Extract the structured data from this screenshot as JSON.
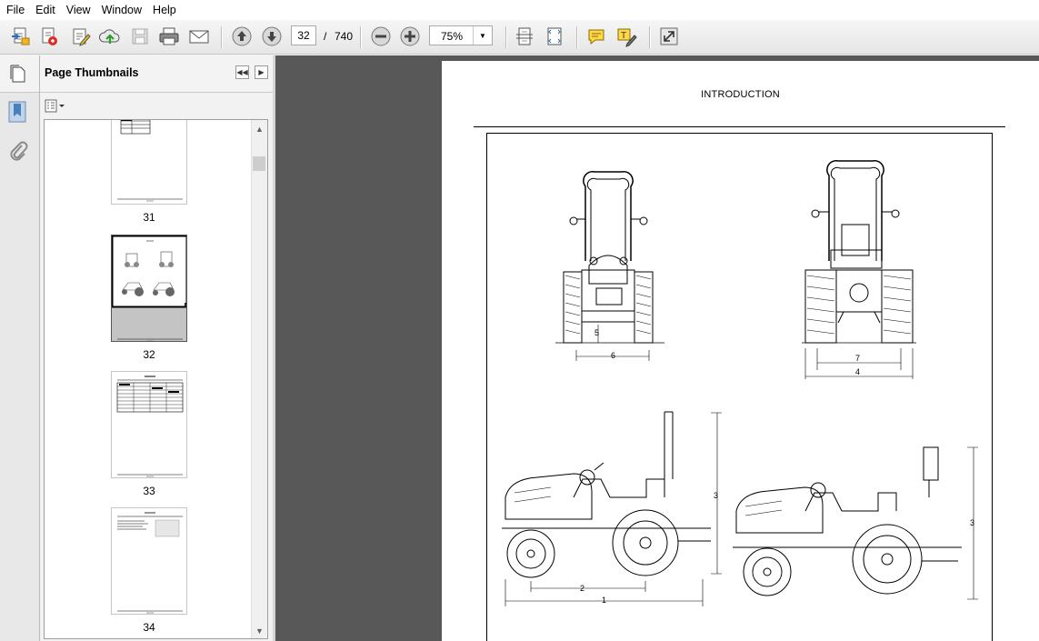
{
  "menu": [
    "File",
    "Edit",
    "View",
    "Window",
    "Help"
  ],
  "toolbar": {
    "current_page": "32",
    "page_separator": "/",
    "total_pages": "740",
    "zoom": "75%",
    "icons": [
      "create-pdf-icon",
      "convert-icon",
      "edit-icon",
      "upload-icon",
      "save-icon",
      "print-icon",
      "email-icon",
      "previous-page-icon",
      "next-page-icon",
      "zoom-out-icon",
      "zoom-in-icon",
      "fit-page-icon",
      "fit-width-icon",
      "comment-icon",
      "highlight-icon",
      "fullscreen-icon"
    ]
  },
  "left_strip": {
    "icons": [
      "pages-panel-icon",
      "bookmark-icon",
      "attachment-icon"
    ]
  },
  "thumbnails_panel": {
    "title": "Page Thumbnails",
    "thumbnails": [
      {
        "label": "31"
      },
      {
        "label": "32",
        "selected": true
      },
      {
        "label": "33"
      },
      {
        "label": "34"
      }
    ]
  },
  "document": {
    "heading": "INTRODUCTION",
    "figure_labels": {
      "front_track": "6",
      "front_height": "5",
      "rear_inner": "7",
      "rear_outer": "4",
      "left_height": "3",
      "left_wheelbase": "2",
      "left_length": "1",
      "right_height": "3"
    }
  }
}
